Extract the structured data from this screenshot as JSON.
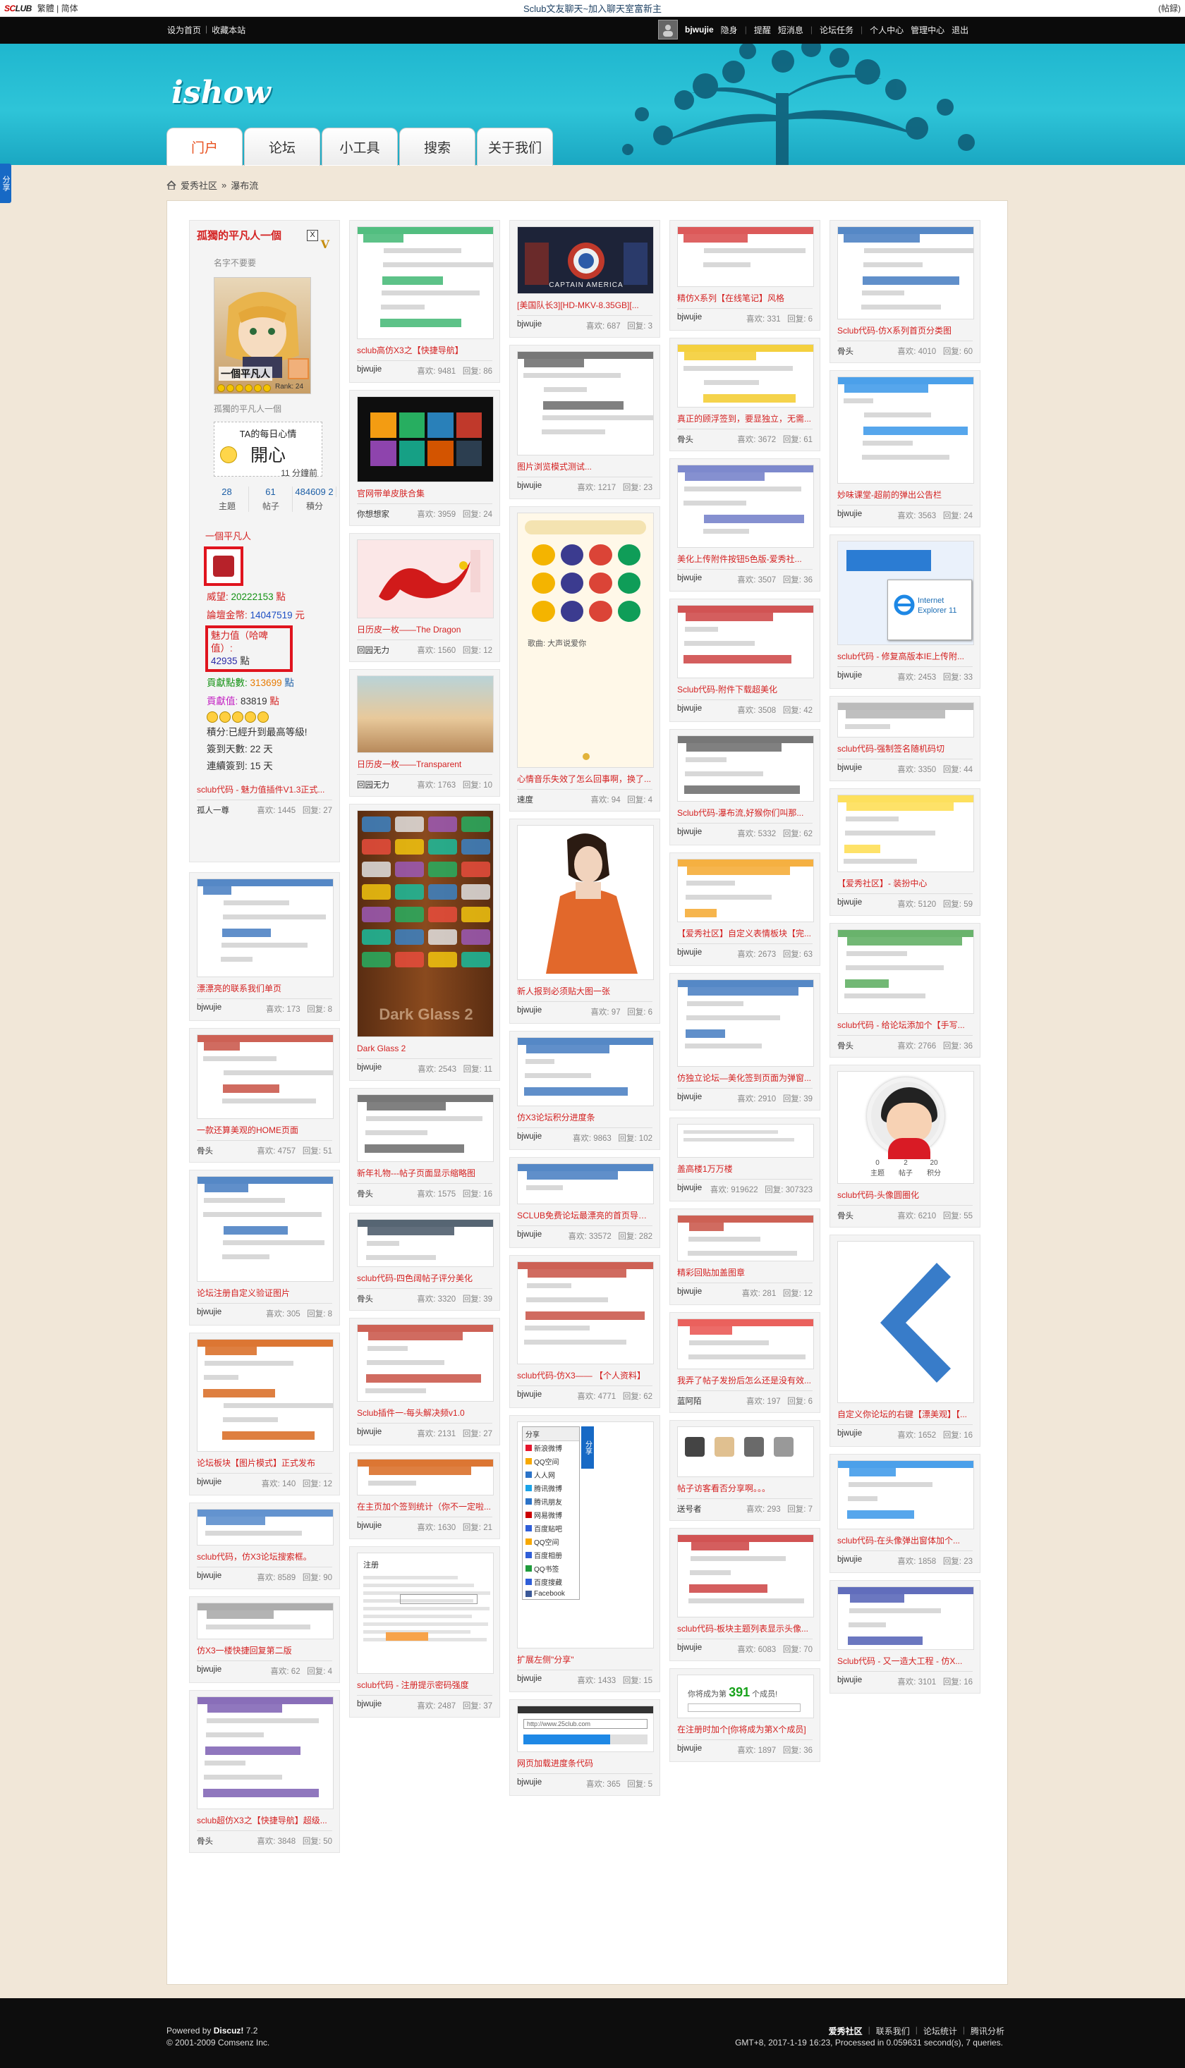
{
  "topbar": {
    "logo_a": "SC",
    "logo_b": "LUB",
    "lang": "繁體 | 简体",
    "center": "Sclub文友聊天~加入聊天室富新主",
    "right": "(帖録)"
  },
  "userbar": {
    "links": [
      "设为首页",
      "收藏本站"
    ],
    "user": "bjwujie",
    "items": [
      "隐身",
      "提醒",
      "短消息",
      "论坛任务",
      "个人中心",
      "管理中心",
      "退出"
    ]
  },
  "banner": {
    "brand": "ishow"
  },
  "nav": [
    "门户",
    "论坛",
    "小工具",
    "搜索",
    "关于我们"
  ],
  "share_side": "分享",
  "breadcrumb": {
    "home": "爱秀社区",
    "sep": "»",
    "current": "瀑布流"
  },
  "profile": {
    "name": "孤獨的平凡人一個",
    "v": "V",
    "x": "X",
    "sig": "名字不要要",
    "rank": "一個平凡人",
    "rk": "Rank: 24",
    "sub": "孤獨的平凡人一個",
    "mood_title": "TA的每日心情",
    "mood_value": "開心",
    "mood_time": "11 分鐘前",
    "stats": [
      {
        "n": "28",
        "l": "主題"
      },
      {
        "n": "61",
        "l": "帖子"
      },
      {
        "n": "484609 2",
        "l": "積分"
      }
    ],
    "group": "一個平凡人",
    "fields": [
      {
        "k": "威望:",
        "v": "20222153",
        "u": "點"
      },
      {
        "k": "論壇金幣:",
        "v": "14047519",
        "u": "元"
      }
    ],
    "love_k": "魅力值（哈啤值）:",
    "love_v": "42935",
    "love_u": "點",
    "contrib": [
      {
        "k": "貢獻點數:",
        "v": "313699",
        "u": "點"
      },
      {
        "k": "貢獻值:",
        "v": "83819",
        "u": "點"
      }
    ],
    "plain": [
      "積分:已經升到最高等級!",
      "簽到天數: 22 天",
      "連續簽到: 15 天"
    ],
    "title": "sclub代码 - 魅力值插件V1.3正式...",
    "author": "孤人一尊",
    "hits": "喜欢: 1445",
    "replies": "回复: 27"
  },
  "columns": [
    [
      {
        "title": "漂漂亮的联系我们单页",
        "author": "bjwujie",
        "hits": "喜欢: 173",
        "replies": "回复: 8"
      },
      {
        "title": "一款还算美观的HOME页面",
        "author": "骨头",
        "hits": "喜欢: 4757",
        "replies": "回复: 51"
      },
      {
        "title": "论坛注册自定义验证图片",
        "author": "bjwujie",
        "hits": "喜欢: 305",
        "replies": "回复: 8"
      },
      {
        "title": "论坛板块【图片模式】正式发布",
        "author": "bjwujie",
        "hits": "喜欢: 140",
        "replies": "回复: 12"
      },
      {
        "title": "sclub代码，仿X3论坛搜索框。",
        "author": "bjwujie",
        "hits": "喜欢: 8589",
        "replies": "回复: 90"
      },
      {
        "title": "仿X3一楼快捷回复第二版",
        "author": "bjwujie",
        "hits": "喜欢: 62",
        "replies": "回复: 4"
      },
      {
        "title": "sclub超仿X3之【快捷导航】超级...",
        "author": "骨头",
        "hits": "喜欢: 3848",
        "replies": "回复: 50"
      }
    ],
    [
      {
        "title": "sclub高仿X3之【快捷导航】",
        "author": "bjwujie",
        "hits": "喜欢: 9481",
        "replies": "回复: 86"
      },
      {
        "title": "官网带单皮肤合集",
        "author": "你想想家",
        "hits": "喜欢: 3959",
        "replies": "回复: 24"
      },
      {
        "title": "日历皮一枚——The Dragon",
        "author": "回园无力",
        "hits": "喜欢: 1560",
        "replies": "回复: 12"
      },
      {
        "title": "日历皮一枚——Transparent",
        "author": "回园无力",
        "hits": "喜欢: 1763",
        "replies": "回复: 10"
      },
      {
        "title": "Dark Glass 2",
        "author": "bjwujie",
        "hits": "喜欢: 2543",
        "replies": "回复: 11"
      },
      {
        "title": "新年礼物---帖子页面显示缩略图",
        "author": "骨头",
        "hits": "喜欢: 1575",
        "replies": "回复: 16"
      },
      {
        "title": "sclub代码-四色阔帖子评分美化",
        "author": "骨头",
        "hits": "喜欢: 3320",
        "replies": "回复: 39"
      },
      {
        "title": "Sclub插件一-每头解决频v1.0",
        "author": "bjwujie",
        "hits": "喜欢: 2131",
        "replies": "回复: 27"
      },
      {
        "title": "在主页加个签到统计（你不一定啦...",
        "author": "bjwujie",
        "hits": "喜欢: 1630",
        "replies": "回复: 21"
      },
      {
        "title": "sclub代码 - 注册提示密码强度",
        "author": "bjwujie",
        "hits": "喜欢: 2487",
        "replies": "回复: 37"
      }
    ],
    [
      {
        "title": "[美国队长3][HD-MKV-8.35GB][...",
        "author": "bjwujie",
        "hits": "喜欢: 687",
        "replies": "回复: 3"
      },
      {
        "title": "图片浏览模式测试...",
        "author": "bjwujie",
        "hits": "喜欢: 1217",
        "replies": "回复: 23"
      },
      {
        "title": "心情音乐失效了怎么回事啊，换了...",
        "author": "速度",
        "hits": "喜欢: 94",
        "replies": "回复: 4"
      },
      {
        "title": "新人报到必须贴大图一张",
        "author": "bjwujie",
        "hits": "喜欢: 97",
        "replies": "回复: 6"
      },
      {
        "title": "仿X3论坛积分进度条",
        "author": "bjwujie",
        "hits": "喜欢: 9863",
        "replies": "回复: 102"
      },
      {
        "title": "SCLUB免费论坛最漂亮的首页导航...",
        "author": "bjwujie",
        "hits": "喜欢: 33572",
        "replies": "回复: 282"
      },
      {
        "title": "sclub代码-仿X3—— 【个人资料】",
        "author": "bjwujie",
        "hits": "喜欢: 4771",
        "replies": "回复: 62"
      },
      {
        "title": "扩展左侧\"分享\"",
        "author": "bjwujie",
        "hits": "喜欢: 1433",
        "replies": "回复: 15"
      },
      {
        "title": "网页加载进度条代码",
        "author": "bjwujie",
        "hits": "喜欢: 365",
        "replies": "回复: 5"
      }
    ],
    [
      {
        "title": "精仿X系列【在线笔记】风格",
        "author": "bjwujie",
        "hits": "喜欢: 331",
        "replies": "回复: 6"
      },
      {
        "title": "真正的顾浮签到，要显独立，无需...",
        "author": "骨头",
        "hits": "喜欢: 3672",
        "replies": "回复: 61"
      },
      {
        "title": "美化上传附件按钮5色版-爱秀社...",
        "author": "bjwujie",
        "hits": "喜欢: 3507",
        "replies": "回复: 36"
      },
      {
        "title": "Sclub代码-附件下载超美化",
        "author": "bjwujie",
        "hits": "喜欢: 3508",
        "replies": "回复: 42"
      },
      {
        "title": "Sclub代码-瀑布流,好猴你们叫那...",
        "author": "bjwujie",
        "hits": "喜欢: 5332",
        "replies": "回复: 62"
      },
      {
        "title": "【爱秀社区】自定义表情板块【完...",
        "author": "bjwujie",
        "hits": "喜欢: 2673",
        "replies": "回复: 63"
      },
      {
        "title": "仿独立论坛—美化签到页面为弹窗...",
        "author": "bjwujie",
        "hits": "喜欢: 2910",
        "replies": "回复: 39"
      },
      {
        "title": "盖高楼1万万楼",
        "author": "bjwujie",
        "hits": "喜欢: 919622",
        "replies": "回复: 307323"
      },
      {
        "title": "精彩回贴加盖图章",
        "author": "bjwujie",
        "hits": "喜欢: 281",
        "replies": "回复: 12"
      },
      {
        "title": "我弄了帖子发扮后怎么还是没有效...",
        "author": "蓝阿陌",
        "hits": "喜欢: 197",
        "replies": "回复: 6"
      },
      {
        "title": "帖子访客看否分享啊。。。",
        "author": "送号者",
        "hits": "喜欢: 293",
        "replies": "回复: 7"
      },
      {
        "title": "sclub代码-板块主题列表显示头像...",
        "author": "bjwujie",
        "hits": "喜欢: 6083",
        "replies": "回复: 70"
      },
      {
        "title": "在注册时加个[你将成为第X个成员]",
        "author": "bjwujie",
        "hits": "喜欢: 1897",
        "replies": "回复: 36"
      }
    ],
    [
      {
        "title": "Sclub代码-仿X系列首页分类图",
        "author": "骨头",
        "hits": "喜欢: 4010",
        "replies": "回复: 60"
      },
      {
        "title": "妙味课堂-超前的弹出公告栏",
        "author": "bjwujie",
        "hits": "喜欢: 3563",
        "replies": "回复: 24"
      },
      {
        "title": "sclub代码 - 修复高版本IE上传附...",
        "author": "bjwujie",
        "hits": "喜欢: 2453",
        "replies": "回复: 33"
      },
      {
        "title": "sclub代码-强制签名随机码切",
        "author": "bjwujie",
        "hits": "喜欢: 3350",
        "replies": "回复: 44"
      },
      {
        "title": "【爱秀社区】- 装扮中心",
        "author": "bjwujie",
        "hits": "喜欢: 5120",
        "replies": "回复: 59"
      },
      {
        "title": "sclub代码 - 给论坛添加个【手写...",
        "author": "骨头",
        "hits": "喜欢: 2766",
        "replies": "回复: 36"
      },
      {
        "title": "sclub代码-头像圆圈化",
        "author": "骨头",
        "hits": "喜欢: 6210",
        "replies": "回复: 55"
      },
      {
        "title": "自定义你论坛的右键【漂美观】【...",
        "author": "bjwujie",
        "hits": "喜欢: 1652",
        "replies": "回复: 16"
      },
      {
        "title": "sclub代码-在头像弹出窗体加个...",
        "author": "bjwujie",
        "hits": "喜欢: 1858",
        "replies": "回复: 23"
      },
      {
        "title": "Sclub代码 - 又一造大工程 - 仿X...",
        "author": "bjwujie",
        "hits": "喜欢: 3101",
        "replies": "回复: 16"
      }
    ]
  ],
  "thumb_text": {
    "movie": "CAPTAIN AMERICA",
    "dark": "Dark Glass 2",
    "share_head": "分享",
    "share_tab": "分享",
    "share_items": [
      "新浪微博",
      "QQ空间",
      "人人网",
      "腾讯微博",
      "腾讯朋友",
      "网易微博",
      "百度贴吧",
      "QQ空间",
      "百度相册",
      "QQ书签",
      "百度搜藏",
      "Facebook"
    ],
    "ie": "Internet Explorer 11",
    "count_prefix": "你将成为第",
    "count_num": "391",
    "count_suffix": "个成员!",
    "avatar_stats": [
      {
        "n": "0",
        "l": "主题"
      },
      {
        "n": "2",
        "l": "帖子"
      },
      {
        "n": "20",
        "l": "积分"
      }
    ],
    "music": "歌曲: 大声说爱你",
    "reg": "注册",
    "url": "http://www.25club.com"
  },
  "footer": {
    "powered": "Powered by",
    "discuz": "Discuz!",
    "ver": "7.2",
    "copyright": "© 2001-2009 Comsenz Inc.",
    "links": [
      "爱秀社区",
      "联系我们",
      "论坛统计",
      "腾讯分析"
    ],
    "stats": "GMT+8, 2017-1-19 16:23, Processed in 0.059631 second(s), 7 queries."
  },
  "colors": {
    "accent": "#d42222",
    "banner": "#1fb7cf",
    "tab_active": "#e8501e",
    "link": "#1d5fa6"
  }
}
